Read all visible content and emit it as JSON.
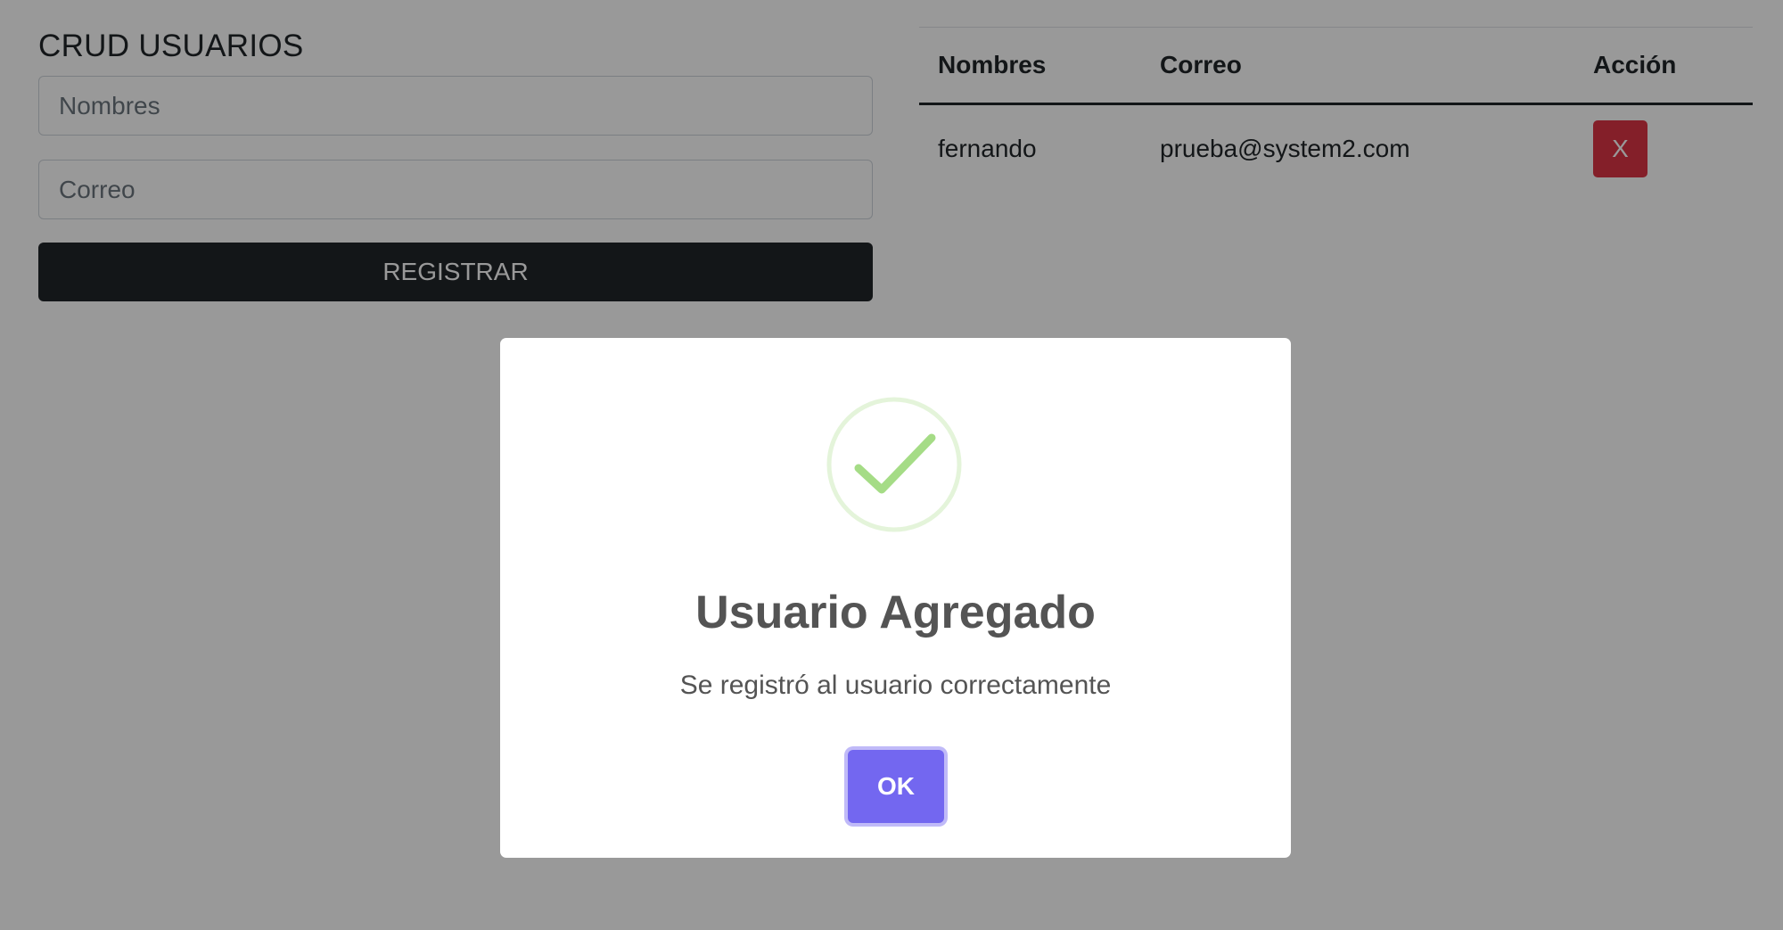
{
  "form": {
    "title": "CRUD USUARIOS",
    "nombres_placeholder": "Nombres",
    "nombres_value": "",
    "correo_placeholder": "Correo",
    "correo_value": "",
    "submit_label": "REGISTRAR"
  },
  "table": {
    "headers": [
      "Nombres",
      "Correo",
      "Acción"
    ],
    "rows": [
      {
        "nombre": "fernando",
        "correo": "prueba@system2.com",
        "action_label": "X"
      }
    ]
  },
  "dialog": {
    "icon": "success-check-icon",
    "title": "Usuario Agregado",
    "text": "Se registró al usuario correctamente",
    "confirm_label": "OK"
  },
  "colors": {
    "primary_dark": "#212529",
    "danger": "#dc3545",
    "confirm": "#7367f0",
    "success": "#a5dc86"
  }
}
